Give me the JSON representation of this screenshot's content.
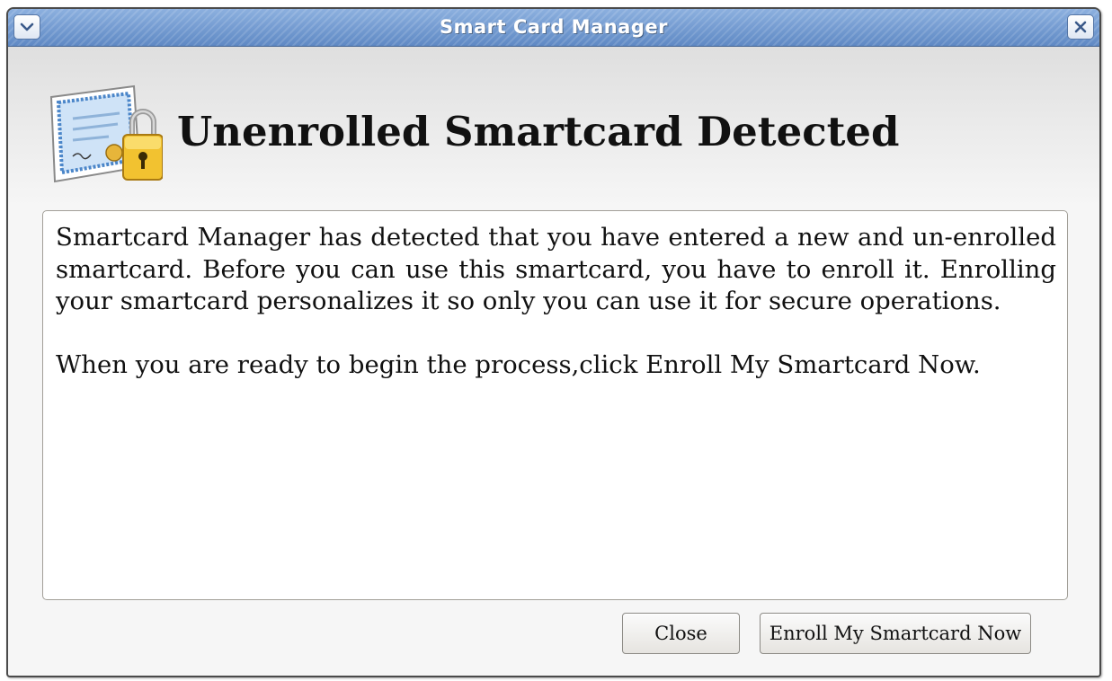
{
  "window": {
    "title": "Smart Card Manager",
    "menu_icon": "chevron-down-icon",
    "close_icon": "close-icon"
  },
  "header": {
    "icon": "certificate-lock-icon",
    "heading": "Unenrolled Smartcard Detected"
  },
  "message": {
    "paragraph1": "Smartcard Manager has detected that you have entered a new and un-enrolled smartcard. Before you can use this smartcard, you have to enroll it. Enrolling your smartcard personalizes it so only you can use it for secure operations.",
    "paragraph2": "When you are ready to begin the process,click Enroll My Smartcard Now."
  },
  "buttons": {
    "close_label": "Close",
    "enroll_label": "Enroll My Smartcard Now"
  },
  "colors": {
    "titlebar": "#6f97cf",
    "window_bg": "#ececec",
    "text": "#111111"
  }
}
